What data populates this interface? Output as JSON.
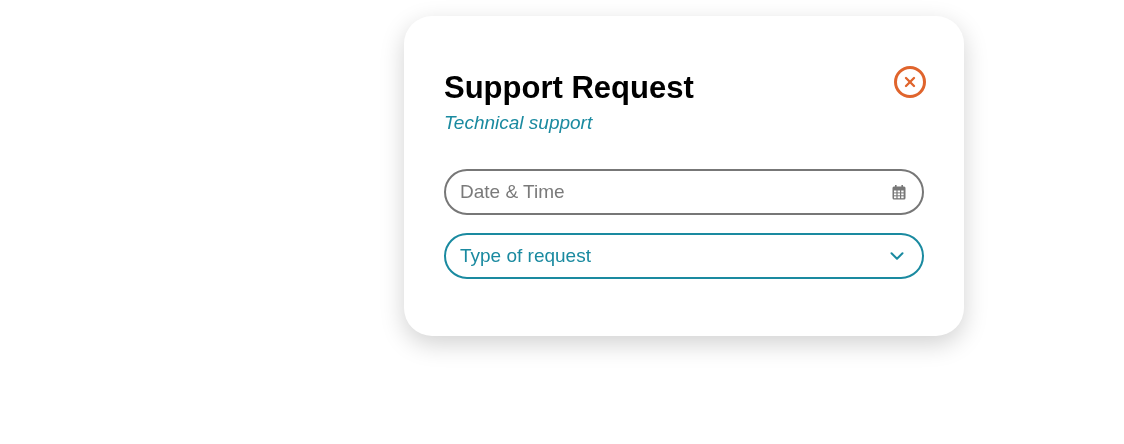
{
  "dialog": {
    "title": "Support Request",
    "subtitle": "Technical support"
  },
  "fields": [
    {
      "kind": "date",
      "placeholder": "Date & Time"
    },
    {
      "kind": "select",
      "placeholder": "Type of request"
    }
  ]
}
